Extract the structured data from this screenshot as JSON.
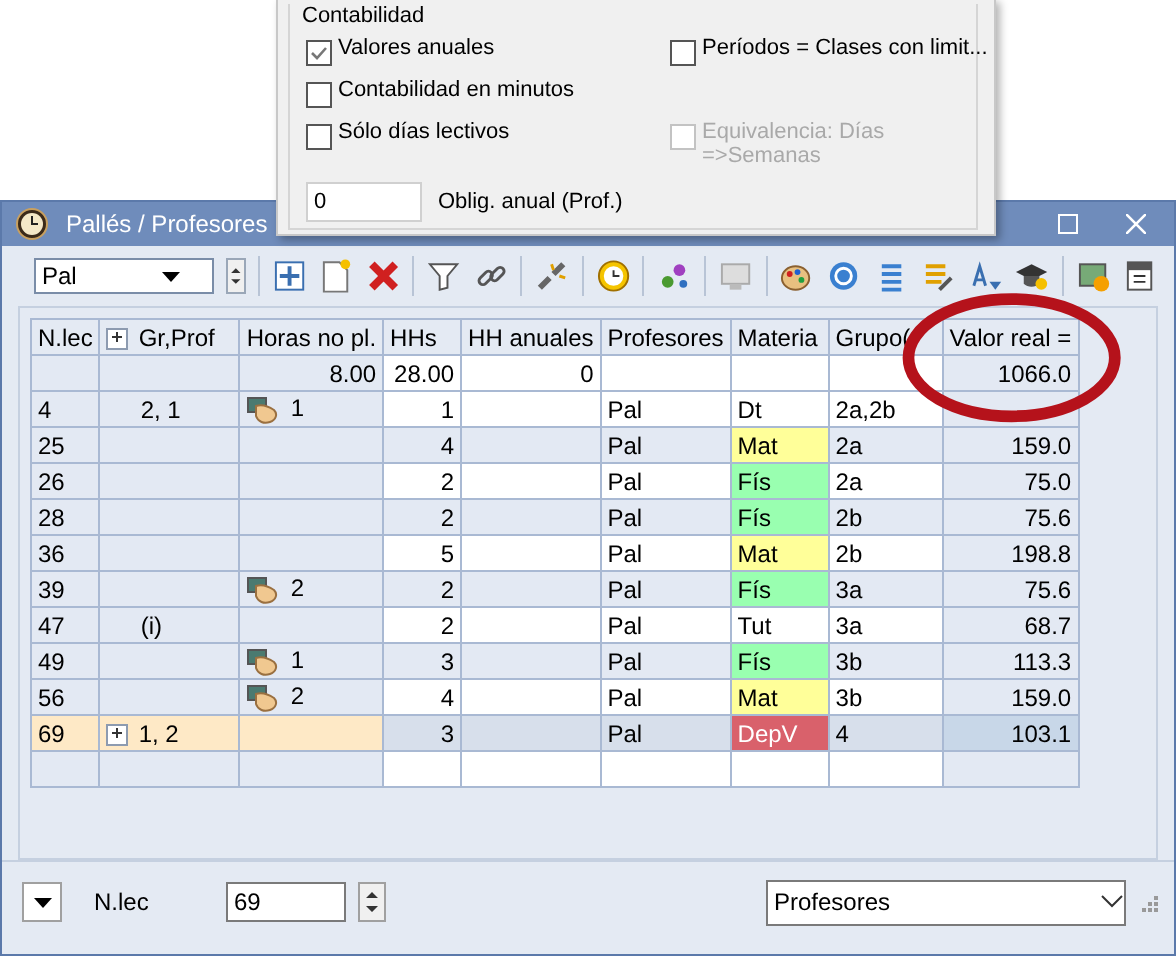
{
  "panel": {
    "title": "Contabilidad",
    "checkboxes": [
      {
        "label": "Valores anuales",
        "checked": true,
        "disabled": false
      },
      {
        "label": "Contabilidad en minutos",
        "checked": false,
        "disabled": false
      },
      {
        "label": "Sólo días lectivos",
        "checked": false,
        "disabled": false
      },
      {
        "label": "Períodos = Clases con limit...",
        "checked": false,
        "disabled": false
      },
      {
        "label": "Equivalencia: Días =>Semanas",
        "checked": false,
        "disabled": true
      }
    ],
    "field": {
      "value": "0",
      "label": "Oblig. anual (Prof.)"
    }
  },
  "window": {
    "title": "Pallés / Profesores"
  },
  "toolbar": {
    "combo": "Pal"
  },
  "table": {
    "columns": [
      {
        "label": "N.lec",
        "expander": false
      },
      {
        "label": "Gr,Prof",
        "expander": true
      },
      {
        "label": "Horas no pl.",
        "expander": false
      },
      {
        "label": "HHs",
        "expander": false
      },
      {
        "label": "HH anuales",
        "expander": false
      },
      {
        "label": "Profesores",
        "expander": false
      },
      {
        "label": "Materia",
        "expander": false
      },
      {
        "label": "Grupo(",
        "expander": false
      },
      {
        "label": "Valor real =",
        "expander": false
      }
    ],
    "totals": {
      "horas": "8.00",
      "hhs": "28.00",
      "hh_anuales": "0",
      "valor": "1066.0"
    },
    "rows": [
      {
        "nlec": "4",
        "gr_prof": "2, 1",
        "expander": false,
        "hand": true,
        "horas": "1",
        "hhs": "1",
        "profesor": "Pal",
        "materia": "Dt",
        "grupo": "2a,2b",
        "selected": false
      },
      {
        "nlec": "25",
        "gr_prof": "",
        "expander": false,
        "hand": false,
        "horas": "",
        "hhs": "4",
        "profesor": "Pal",
        "materia": "Mat",
        "color": "#ffff99",
        "grupo": "2a",
        "valor": "159.0",
        "selected": false
      },
      {
        "nlec": "26",
        "gr_prof": "",
        "expander": false,
        "hand": false,
        "horas": "",
        "hhs": "2",
        "profesor": "Pal",
        "materia": "Fís",
        "color": "#99ffb0",
        "grupo": "2a",
        "valor": "75.0",
        "selected": false
      },
      {
        "nlec": "28",
        "gr_prof": "",
        "expander": false,
        "hand": false,
        "horas": "",
        "hhs": "2",
        "profesor": "Pal",
        "materia": "Fís",
        "color": "#99ffb0",
        "grupo": "2b",
        "valor": "75.6",
        "selected": false
      },
      {
        "nlec": "36",
        "gr_prof": "",
        "expander": false,
        "hand": false,
        "horas": "",
        "hhs": "5",
        "profesor": "Pal",
        "materia": "Mat",
        "color": "#ffff99",
        "grupo": "2b",
        "valor": "198.8",
        "selected": false
      },
      {
        "nlec": "39",
        "gr_prof": "",
        "expander": false,
        "hand": true,
        "horas": "2",
        "hhs": "2",
        "profesor": "Pal",
        "materia": "Fís",
        "color": "#99ffb0",
        "grupo": "3a",
        "valor": "75.6",
        "selected": false
      },
      {
        "nlec": "47",
        "gr_prof": "(i)",
        "expander": false,
        "hand": false,
        "horas": "",
        "hhs": "2",
        "profesor": "Pal",
        "materia": "Tut",
        "grupo": "3a",
        "valor": "68.7",
        "selected": false
      },
      {
        "nlec": "49",
        "gr_prof": "",
        "expander": false,
        "hand": true,
        "horas": "1",
        "hhs": "3",
        "profesor": "Pal",
        "materia": "Fís",
        "color": "#99ffb0",
        "grupo": "3b",
        "valor": "113.3",
        "selected": false
      },
      {
        "nlec": "56",
        "gr_prof": "",
        "expander": false,
        "hand": true,
        "horas": "2",
        "hhs": "4",
        "profesor": "Pal",
        "materia": "Mat",
        "color": "#ffff99",
        "grupo": "3b",
        "valor": "159.0",
        "selected": false
      },
      {
        "nlec": "69",
        "gr_prof": "1, 2",
        "expander": true,
        "hand": false,
        "horas": "",
        "hhs": "3",
        "profesor": "Pal",
        "materia": "DepV",
        "color": "#d9616b",
        "grupo": "4",
        "valor": "103.1",
        "selected": true
      }
    ]
  },
  "footer": {
    "label": "N.lec",
    "value": "69",
    "view": "Profesores"
  }
}
